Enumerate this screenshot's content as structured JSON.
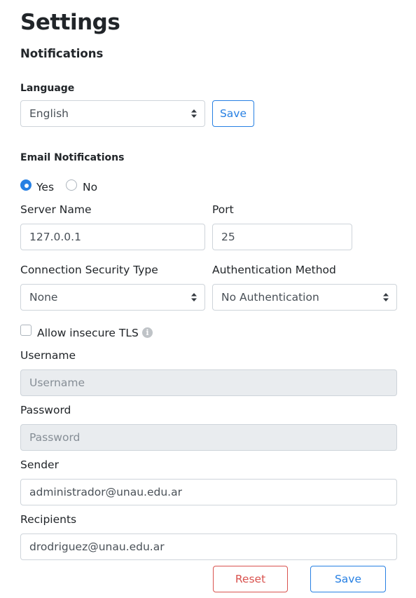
{
  "page": {
    "title": "Settings",
    "section_title": "Notifications"
  },
  "language": {
    "label": "Language",
    "selected": "English",
    "save_label": "Save"
  },
  "email_notifications": {
    "label": "Email Notifications",
    "yes_label": "Yes",
    "no_label": "No",
    "selected": "Yes"
  },
  "server": {
    "name_label": "Server Name",
    "name_value": "127.0.0.1",
    "port_label": "Port",
    "port_value": "25"
  },
  "security": {
    "type_label": "Connection Security Type",
    "type_selected": "None",
    "auth_label": "Authentication Method",
    "auth_selected": "No Authentication"
  },
  "tls": {
    "label": "Allow insecure TLS",
    "checked": false,
    "info_icon": "info-icon"
  },
  "credentials": {
    "username_label": "Username",
    "username_placeholder": "Username",
    "password_label": "Password",
    "password_placeholder": "Password"
  },
  "sender": {
    "label": "Sender",
    "value": "administrador@unau.edu.ar"
  },
  "recipients": {
    "label": "Recipients",
    "value": "drodriguez@unau.edu.ar"
  },
  "footer": {
    "reset_label": "Reset",
    "save_label": "Save"
  },
  "colors": {
    "primary": "#2780e3",
    "danger": "#d9534f",
    "disabled_bg": "#e9ecef",
    "border": "#ced4da"
  }
}
